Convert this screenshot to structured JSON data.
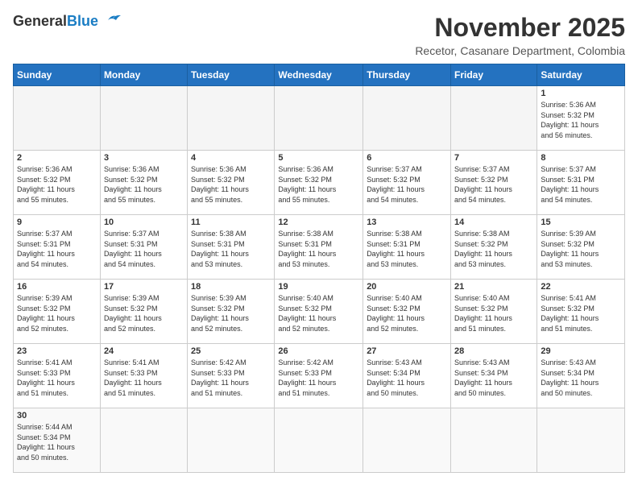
{
  "header": {
    "logo_general": "General",
    "logo_blue": "Blue",
    "month_title": "November 2025",
    "subtitle": "Recetor, Casanare Department, Colombia"
  },
  "days_of_week": [
    "Sunday",
    "Monday",
    "Tuesday",
    "Wednesday",
    "Thursday",
    "Friday",
    "Saturday"
  ],
  "weeks": [
    [
      {
        "day": "",
        "info": ""
      },
      {
        "day": "",
        "info": ""
      },
      {
        "day": "",
        "info": ""
      },
      {
        "day": "",
        "info": ""
      },
      {
        "day": "",
        "info": ""
      },
      {
        "day": "",
        "info": ""
      },
      {
        "day": "1",
        "info": "Sunrise: 5:36 AM\nSunset: 5:32 PM\nDaylight: 11 hours\nand 56 minutes."
      }
    ],
    [
      {
        "day": "2",
        "info": "Sunrise: 5:36 AM\nSunset: 5:32 PM\nDaylight: 11 hours\nand 55 minutes."
      },
      {
        "day": "3",
        "info": "Sunrise: 5:36 AM\nSunset: 5:32 PM\nDaylight: 11 hours\nand 55 minutes."
      },
      {
        "day": "4",
        "info": "Sunrise: 5:36 AM\nSunset: 5:32 PM\nDaylight: 11 hours\nand 55 minutes."
      },
      {
        "day": "5",
        "info": "Sunrise: 5:36 AM\nSunset: 5:32 PM\nDaylight: 11 hours\nand 55 minutes."
      },
      {
        "day": "6",
        "info": "Sunrise: 5:37 AM\nSunset: 5:32 PM\nDaylight: 11 hours\nand 54 minutes."
      },
      {
        "day": "7",
        "info": "Sunrise: 5:37 AM\nSunset: 5:32 PM\nDaylight: 11 hours\nand 54 minutes."
      },
      {
        "day": "8",
        "info": "Sunrise: 5:37 AM\nSunset: 5:31 PM\nDaylight: 11 hours\nand 54 minutes."
      }
    ],
    [
      {
        "day": "9",
        "info": "Sunrise: 5:37 AM\nSunset: 5:31 PM\nDaylight: 11 hours\nand 54 minutes."
      },
      {
        "day": "10",
        "info": "Sunrise: 5:37 AM\nSunset: 5:31 PM\nDaylight: 11 hours\nand 54 minutes."
      },
      {
        "day": "11",
        "info": "Sunrise: 5:38 AM\nSunset: 5:31 PM\nDaylight: 11 hours\nand 53 minutes."
      },
      {
        "day": "12",
        "info": "Sunrise: 5:38 AM\nSunset: 5:31 PM\nDaylight: 11 hours\nand 53 minutes."
      },
      {
        "day": "13",
        "info": "Sunrise: 5:38 AM\nSunset: 5:31 PM\nDaylight: 11 hours\nand 53 minutes."
      },
      {
        "day": "14",
        "info": "Sunrise: 5:38 AM\nSunset: 5:32 PM\nDaylight: 11 hours\nand 53 minutes."
      },
      {
        "day": "15",
        "info": "Sunrise: 5:39 AM\nSunset: 5:32 PM\nDaylight: 11 hours\nand 53 minutes."
      }
    ],
    [
      {
        "day": "16",
        "info": "Sunrise: 5:39 AM\nSunset: 5:32 PM\nDaylight: 11 hours\nand 52 minutes."
      },
      {
        "day": "17",
        "info": "Sunrise: 5:39 AM\nSunset: 5:32 PM\nDaylight: 11 hours\nand 52 minutes."
      },
      {
        "day": "18",
        "info": "Sunrise: 5:39 AM\nSunset: 5:32 PM\nDaylight: 11 hours\nand 52 minutes."
      },
      {
        "day": "19",
        "info": "Sunrise: 5:40 AM\nSunset: 5:32 PM\nDaylight: 11 hours\nand 52 minutes."
      },
      {
        "day": "20",
        "info": "Sunrise: 5:40 AM\nSunset: 5:32 PM\nDaylight: 11 hours\nand 52 minutes."
      },
      {
        "day": "21",
        "info": "Sunrise: 5:40 AM\nSunset: 5:32 PM\nDaylight: 11 hours\nand 51 minutes."
      },
      {
        "day": "22",
        "info": "Sunrise: 5:41 AM\nSunset: 5:32 PM\nDaylight: 11 hours\nand 51 minutes."
      }
    ],
    [
      {
        "day": "23",
        "info": "Sunrise: 5:41 AM\nSunset: 5:33 PM\nDaylight: 11 hours\nand 51 minutes."
      },
      {
        "day": "24",
        "info": "Sunrise: 5:41 AM\nSunset: 5:33 PM\nDaylight: 11 hours\nand 51 minutes."
      },
      {
        "day": "25",
        "info": "Sunrise: 5:42 AM\nSunset: 5:33 PM\nDaylight: 11 hours\nand 51 minutes."
      },
      {
        "day": "26",
        "info": "Sunrise: 5:42 AM\nSunset: 5:33 PM\nDaylight: 11 hours\nand 51 minutes."
      },
      {
        "day": "27",
        "info": "Sunrise: 5:43 AM\nSunset: 5:34 PM\nDaylight: 11 hours\nand 50 minutes."
      },
      {
        "day": "28",
        "info": "Sunrise: 5:43 AM\nSunset: 5:34 PM\nDaylight: 11 hours\nand 50 minutes."
      },
      {
        "day": "29",
        "info": "Sunrise: 5:43 AM\nSunset: 5:34 PM\nDaylight: 11 hours\nand 50 minutes."
      }
    ],
    [
      {
        "day": "30",
        "info": "Sunrise: 5:44 AM\nSunset: 5:34 PM\nDaylight: 11 hours\nand 50 minutes."
      },
      {
        "day": "",
        "info": ""
      },
      {
        "day": "",
        "info": ""
      },
      {
        "day": "",
        "info": ""
      },
      {
        "day": "",
        "info": ""
      },
      {
        "day": "",
        "info": ""
      },
      {
        "day": "",
        "info": ""
      }
    ]
  ]
}
